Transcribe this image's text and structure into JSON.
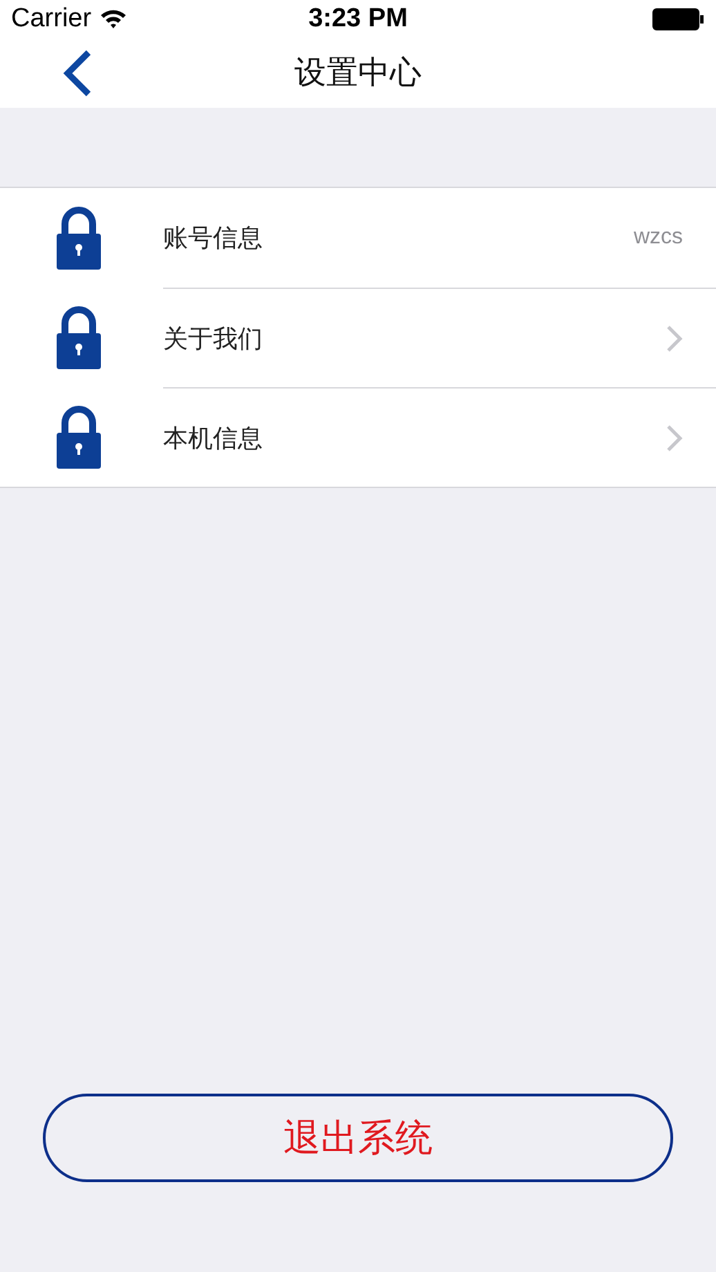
{
  "status_bar": {
    "carrier": "Carrier",
    "time": "3:23 PM"
  },
  "nav": {
    "title": "设置中心"
  },
  "items": [
    {
      "kind": "value",
      "label": "账号信息",
      "value": "wzcs"
    },
    {
      "kind": "link",
      "label": "关于我们"
    },
    {
      "kind": "link",
      "label": "本机信息"
    }
  ],
  "logout_button": "退出系统"
}
